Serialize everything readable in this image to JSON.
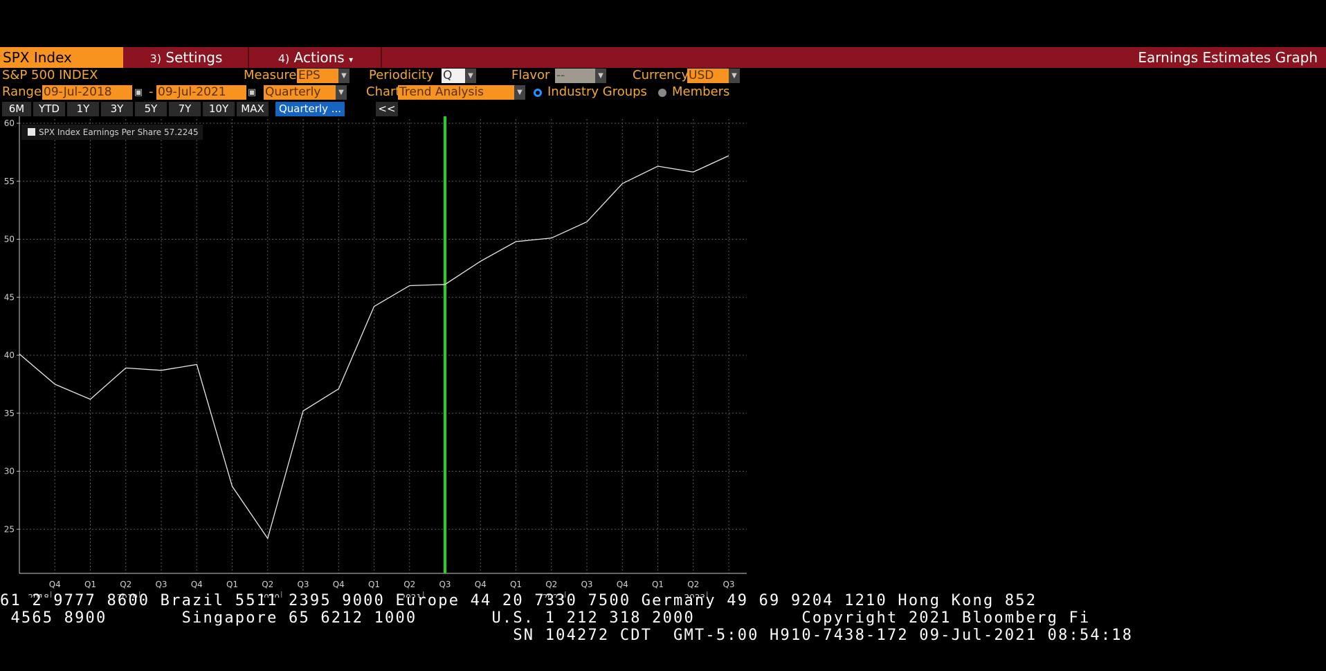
{
  "header": {
    "ticker": "SPX Index",
    "settings_num": "3)",
    "settings_label": "Settings",
    "actions_num": "4)",
    "actions_label": "Actions",
    "actions_caret": "▾",
    "page_title": "Earnings Estimates Graph"
  },
  "controls": {
    "security_name": "S&P 500 INDEX",
    "measure_label": "Measure",
    "measure_value": "EPS",
    "periodicity_label": "Periodicity",
    "periodicity_value": "Q",
    "flavor_label": "Flavor",
    "flavor_value": "--",
    "currency_label": "Currency",
    "currency_value": "USD",
    "range_label": "Range",
    "range_start": "09-Jul-2018",
    "range_sep": "-",
    "range_end": "09-Jul-2021",
    "frequency_value": "Quarterly",
    "chart_label": "Chart",
    "chart_value": "Trend Analysis",
    "radio_industry": "Industry Groups",
    "radio_members": "Members"
  },
  "range_buttons": [
    "6M",
    "YTD",
    "1Y",
    "3Y",
    "5Y",
    "7Y",
    "10Y",
    "MAX"
  ],
  "quarterly_button": "Quarterly ...",
  "collapse_button": "<<",
  "chart_data": {
    "type": "line",
    "legend": "SPX Index Earnings Per Share 57.2245",
    "ylim": [
      20,
      60
    ],
    "yticks": [
      25,
      30,
      35,
      40,
      45,
      50,
      55,
      60
    ],
    "x": [
      "Q3 2018",
      "Q4 2018",
      "Q1 2019",
      "Q2 2019",
      "Q3 2019",
      "Q4 2019",
      "Q1 2020",
      "Q2 2020",
      "Q3 2020",
      "Q4 2020",
      "Q1 2021",
      "Q2 2021",
      "Q3 2021",
      "Q4 2021",
      "Q1 2022",
      "Q2 2022",
      "Q3 2022",
      "Q4 2022",
      "Q1 2023",
      "Q2 2023",
      "Q3 2023"
    ],
    "quarter_labels": [
      "Q4",
      "Q1",
      "Q2",
      "Q3",
      "Q4",
      "Q1",
      "Q2",
      "Q3",
      "Q4",
      "Q1",
      "Q2",
      "Q3",
      "Q4",
      "Q1",
      "Q2",
      "Q3",
      "Q4",
      "Q1",
      "Q2",
      "Q3"
    ],
    "year_labels": [
      "2018",
      "2019",
      "2020",
      "2021",
      "2022",
      "2023"
    ],
    "series": [
      {
        "values": [
          40.1,
          37.5,
          36.2,
          38.9,
          38.7,
          39.2,
          28.7,
          24.2,
          35.2,
          37.1,
          44.2,
          46.0,
          46.1,
          48.1,
          49.8,
          50.1,
          51.5,
          54.8,
          56.3,
          55.8,
          57.2
        ]
      }
    ],
    "current_marker_x": "Q3 2021",
    "colors": {
      "line": "#e8e8e8",
      "marker": "#22d31a",
      "grid": "#5a5a5a"
    },
    "grid": true,
    "legend_position": "top-left"
  },
  "terminal": {
    "line1": "61 2 9777 8600 Brazil 5511 2395 9000 Europe 44 20 7330 7500 Germany 49 69 9204 1210 Hong Kong 852",
    "line2": " 4565 8900       Singapore 65 6212 1000       U.S. 1 212 318 2000          Copyright 2021 Bloomberg Fi",
    "line3": "                                                SN 104272 CDT  GMT-5:00 H910-7438-172 09-Jul-2021 08:54:18"
  }
}
